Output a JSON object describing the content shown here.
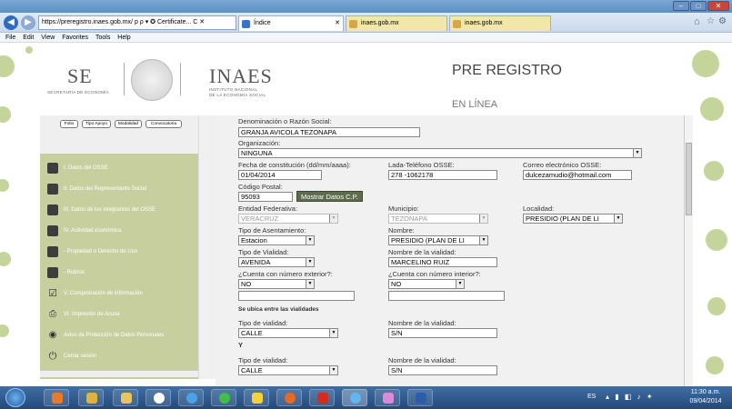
{
  "window": {
    "title_blur": "",
    "min_label": "–",
    "max_label": "□",
    "close_label": "✕"
  },
  "browser": {
    "address": "https://preregistro.inaes.gob.mx/ p ρ ▾ ✪ Certificate... C ✕",
    "tabs": [
      {
        "label": "Índice"
      },
      {
        "label": "inaes.gob.mx"
      },
      {
        "label": "inaes.gob.mx"
      }
    ],
    "menu": [
      "File",
      "Edit",
      "View",
      "Favorites",
      "Tools",
      "Help"
    ]
  },
  "header": {
    "se_logo": "SE",
    "se_sub": "SECRETARÍA DE ECONOMÍA",
    "inaes_logo": "INAES",
    "inaes_sub1": "INSTITUTO NACIONAL",
    "inaes_sub2": "DE LA ECONOMÍA SOCIAL",
    "title": "PRE REGISTRO",
    "subtitle": "EN LÍNEA"
  },
  "sidebar": {
    "tabs": [
      "Folio",
      "Tipo Apoyo",
      "Modalidad",
      "Convocatoria"
    ],
    "items": [
      {
        "label": "I. Datos del OSSE"
      },
      {
        "label": "II. Datos del Representante Social"
      },
      {
        "label": "III. Datos de los integrantes del OSSE"
      },
      {
        "label": "IV. Actividad económica"
      },
      {
        "label": "- Propiedad o Derecho de Uso"
      },
      {
        "label": "- Rubros"
      },
      {
        "label": "V. Comprobación de información"
      },
      {
        "label": "VI. Impresión de Acuse"
      },
      {
        "label": "Aviso de Protección de Datos Personales"
      },
      {
        "label": "Cerrar sesión"
      }
    ]
  },
  "form": {
    "denominacion_label": "Denominación o Razón Social:",
    "denominacion_value": "GRANJA AVICOLA TEZONAPA",
    "organizacion_label": "Organización:",
    "organizacion_value": "NINGUNA",
    "fecha_label": "Fecha de constitución (dd/mm/aaaa):",
    "fecha_value": "01/04/2014",
    "lada_label": "Lada-Teléfono OSSE:",
    "lada_value": "278 -1062178",
    "correo_label": "Correo electrónico OSSE:",
    "correo_value": "dulcezamudio@hotmail.com",
    "cp_label": "Código Postal:",
    "cp_value": "95093",
    "cp_button": "Mostrar Datos C.P.",
    "entidad_label": "Entidad Federativa:",
    "entidad_value": "VERACRUZ",
    "municipio_label": "Municipio:",
    "municipio_value": "TEZONAPA",
    "localidad_label": "Localidad:",
    "localidad_value": "PRESIDIO (PLAN DE LI",
    "asentamiento_label": "Tipo de Asentamiento:",
    "asentamiento_value": "Estacion",
    "nombre_label": "Nombre:",
    "nombre_value": "PRESIDIO (PLAN DE LI",
    "vialidad_label": "Tipo de Vialidad:",
    "vialidad_value": "AVENIDA",
    "nombre_vialidad_label": "Nombre de la vialidad:",
    "nombre_vialidad_value": "MARCELINO RUIZ",
    "num_ext_label": "¿Cuenta con número exterior?:",
    "num_ext_value": "NO",
    "num_int_label": "¿Cuenta con número interior?:",
    "num_int_value": "NO",
    "entre_label": "Se ubica entre las vialidades",
    "tipo_vialidad1_label": "Tipo de vialidad:",
    "tipo_vialidad1_value": "CALLE",
    "nombre_vialidad1_label": "Nombre de la vialidad:",
    "nombre_vialidad1_value": "S/N",
    "y_label": "Y",
    "tipo_vialidad2_label": "Tipo de vialidad:",
    "tipo_vialidad2_value": "CALLE",
    "nombre_vialidad2_label": "Nombre de la vialidad:",
    "nombre_vialidad2_value": "S/N"
  },
  "taskbar": {
    "lang": "ES",
    "time": "11:30 a.m.",
    "date": "09/04/2014"
  },
  "colors": {
    "sidebar": "#c8cf9f",
    "accent_button": "#5e6b4c",
    "taskbar": "#24497a"
  }
}
